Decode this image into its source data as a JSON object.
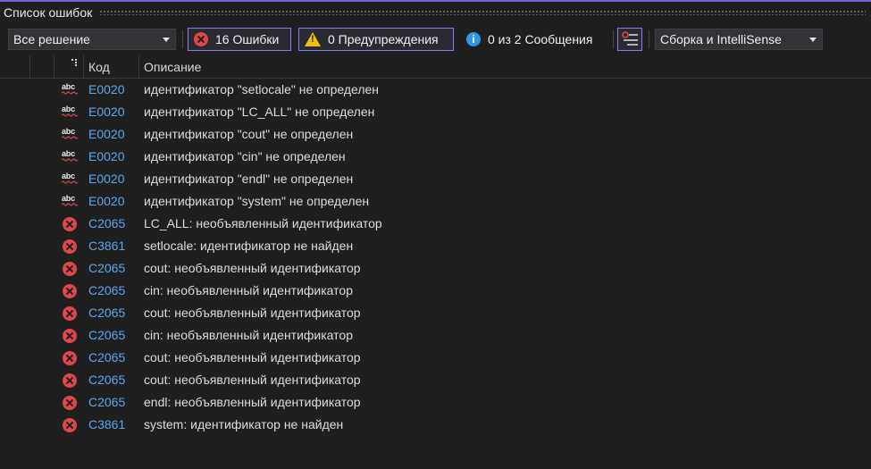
{
  "window": {
    "title": "Список ошибок"
  },
  "toolbar": {
    "scope_selected": "Все решение",
    "errors_label": "16 Ошибки",
    "warnings_label": "0 Предупреждения",
    "messages_label": "0 из 2 Сообщения",
    "build_selected": "Сборка и IntelliSense"
  },
  "columns": {
    "code": "Код",
    "description": "Описание"
  },
  "rows": [
    {
      "icon": "spell-check-icon",
      "code": "E0020",
      "description": "идентификатор \"setlocale\" не определен"
    },
    {
      "icon": "spell-check-icon",
      "code": "E0020",
      "description": "идентификатор \"LC_ALL\" не определен"
    },
    {
      "icon": "spell-check-icon",
      "code": "E0020",
      "description": "идентификатор \"cout\" не определен"
    },
    {
      "icon": "spell-check-icon",
      "code": "E0020",
      "description": "идентификатор \"cin\" не определен"
    },
    {
      "icon": "spell-check-icon",
      "code": "E0020",
      "description": "идентификатор \"endl\" не определен"
    },
    {
      "icon": "spell-check-icon",
      "code": "E0020",
      "description": "идентификатор \"system\" не определен"
    },
    {
      "icon": "error-icon",
      "code": "C2065",
      "description": "LC_ALL: необъявленный идентификатор"
    },
    {
      "icon": "error-icon",
      "code": "C3861",
      "description": "setlocale: идентификатор не найден"
    },
    {
      "icon": "error-icon",
      "code": "C2065",
      "description": "cout: необъявленный идентификатор"
    },
    {
      "icon": "error-icon",
      "code": "C2065",
      "description": "cin: необъявленный идентификатор"
    },
    {
      "icon": "error-icon",
      "code": "C2065",
      "description": "cout: необъявленный идентификатор"
    },
    {
      "icon": "error-icon",
      "code": "C2065",
      "description": "cin: необъявленный идентификатор"
    },
    {
      "icon": "error-icon",
      "code": "C2065",
      "description": "cout: необъявленный идентификатор"
    },
    {
      "icon": "error-icon",
      "code": "C2065",
      "description": "cout: необъявленный идентификатор"
    },
    {
      "icon": "error-icon",
      "code": "C2065",
      "description": "endl: необъявленный идентификатор"
    },
    {
      "icon": "error-icon",
      "code": "C3861",
      "description": "system: идентификатор не найден"
    }
  ],
  "colors": {
    "background": "#1f1f1f",
    "accent": "#7a5fd6",
    "error": "#e0474c",
    "warning": "#f2c10f",
    "info": "#2f95e8",
    "code_link": "#5ba6f0"
  }
}
